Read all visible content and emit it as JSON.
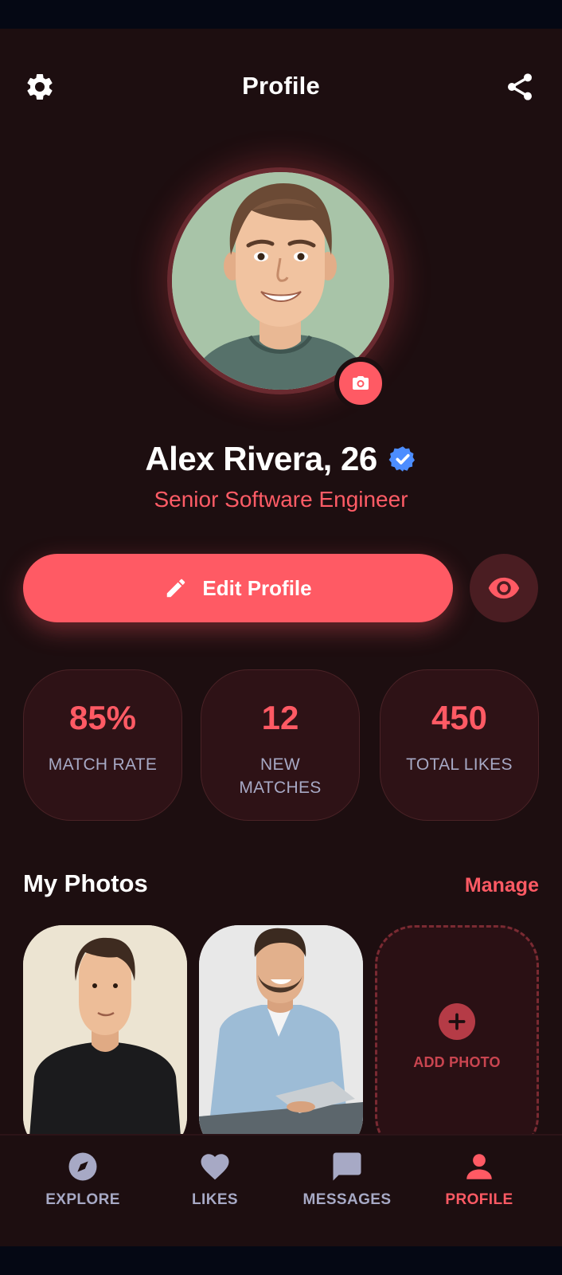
{
  "header": {
    "title": "Profile",
    "settings_icon": "gear-icon",
    "share_icon": "share-icon"
  },
  "profile": {
    "name": "Alex Rivera, 26",
    "job": "Senior Software Engineer",
    "verified_icon": "verified-badge-icon",
    "camera_icon": "camera-icon"
  },
  "actions": {
    "edit_label": "Edit Profile",
    "edit_icon": "pencil-icon",
    "preview_icon": "eye-icon"
  },
  "stats": [
    {
      "value": "85%",
      "label": "MATCH RATE"
    },
    {
      "value": "12",
      "label": "NEW MATCHES"
    },
    {
      "value": "450",
      "label": "TOTAL LIKES"
    }
  ],
  "photos": {
    "title": "My Photos",
    "manage": "Manage",
    "add_label": "ADD PHOTO"
  },
  "nav": {
    "items": [
      {
        "label": "EXPLORE",
        "icon": "compass-icon",
        "active": false
      },
      {
        "label": "LIKES",
        "icon": "heart-icon",
        "active": false
      },
      {
        "label": "MESSAGES",
        "icon": "chat-icon",
        "active": false
      },
      {
        "label": "PROFILE",
        "icon": "person-icon",
        "active": true
      }
    ]
  },
  "colors": {
    "accent": "#ff5a64",
    "background": "#1d0e10",
    "card": "#2e1216",
    "muted_text": "#a7a9c5",
    "verified": "#4c8dff"
  }
}
